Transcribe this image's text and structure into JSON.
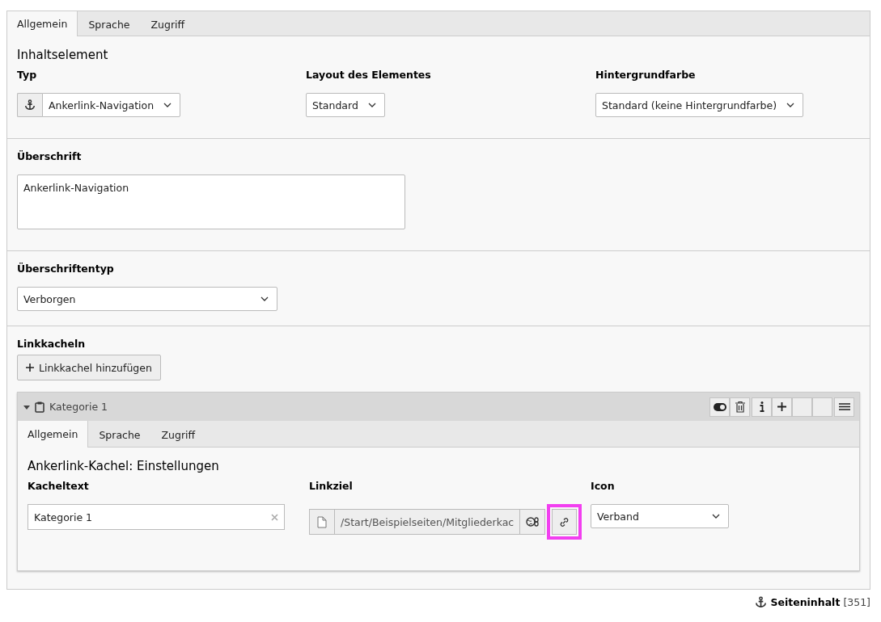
{
  "tabs": [
    {
      "label": "Allgemein",
      "selected": true
    },
    {
      "label": "Sprache",
      "selected": false
    },
    {
      "label": "Zugriff",
      "selected": false
    }
  ],
  "section_title": "Inhaltselement",
  "top_fields": [
    {
      "label": "Typ",
      "value": "Ankerlink-Navigation",
      "kind": "icon_select"
    },
    {
      "label": "Layout des Elementes",
      "value": "Standard",
      "kind": "select"
    },
    {
      "label": "Hintergrundfarbe",
      "value": "Standard (keine Hintergrundfarbe)",
      "kind": "select"
    }
  ],
  "heading": {
    "label": "Überschrift",
    "value": "Ankerlink-Navigation"
  },
  "heading_type": {
    "label": "Überschriftentyp",
    "value": "Verborgen"
  },
  "tiles": {
    "label": "Linkkacheln",
    "add_button": "Linkkachel hinzufügen",
    "items": [
      {
        "title": "Kategorie 1",
        "expanded": true,
        "tabs": [
          {
            "label": "Allgemein",
            "selected": true
          },
          {
            "label": "Sprache",
            "selected": false
          },
          {
            "label": "Zugriff",
            "selected": false
          }
        ],
        "section_title": "Ankerlink-Kachel: Einstellungen",
        "text_field": {
          "label": "Kacheltext",
          "value": "Kategorie 1"
        },
        "link_field": {
          "label": "Linkziel",
          "value": "/Start/Beispielseiten/Mitgliederkac",
          "link_button_highlighted": true
        },
        "icon_field": {
          "label": "Icon",
          "value": "Verband"
        }
      }
    ]
  },
  "footer": {
    "title": "Seiteninhalt",
    "id": "[351]"
  }
}
